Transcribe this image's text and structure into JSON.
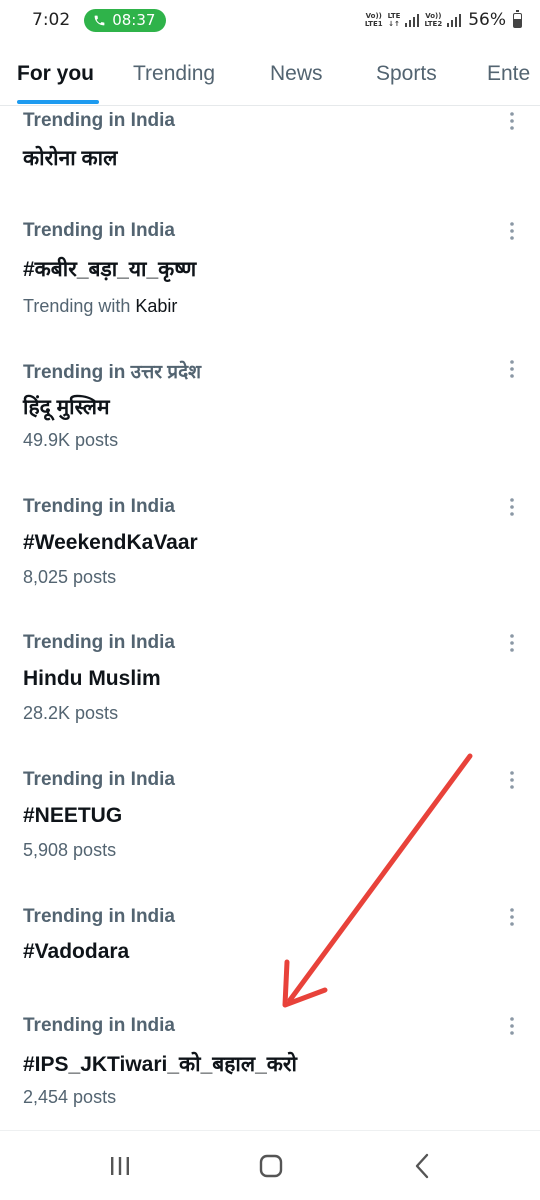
{
  "status_bar": {
    "time": "7:02",
    "call_timer": "08:37",
    "sim1_tag": [
      "Vo))",
      "LTE1"
    ],
    "lte_tag": [
      "LTE",
      "↓↑"
    ],
    "sim2_tag": [
      "Vo))",
      "LTE2"
    ],
    "battery": "56%",
    "battery_level": 0.56
  },
  "tabs": [
    {
      "label": "For you",
      "active": true
    },
    {
      "label": "Trending",
      "active": false
    },
    {
      "label": "News",
      "active": false
    },
    {
      "label": "Sports",
      "active": false
    },
    {
      "label": "Ente",
      "active": false
    }
  ],
  "trends": [
    {
      "context": "Trending in India",
      "title": "कोरोना काल",
      "meta": ""
    },
    {
      "context": "Trending in India",
      "title": "#कबीर_बड़ा_या_कृष्ण",
      "meta_prefix": "Trending with ",
      "meta_highlight": "Kabir"
    },
    {
      "context": "Trending in उत्तर प्रदेश",
      "title": "हिंदू मुस्लिम",
      "meta": "49.9K posts"
    },
    {
      "context": "Trending in India",
      "title": "#WeekendKaVaar",
      "meta": "8,025 posts"
    },
    {
      "context": "Trending in India",
      "title": "Hindu Muslim",
      "meta": "28.2K posts"
    },
    {
      "context": "Trending in India",
      "title": "#NEETUG",
      "meta": "5,908 posts"
    },
    {
      "context": "Trending in India",
      "title": "#Vadodara",
      "meta": ""
    },
    {
      "context": "Trending in India",
      "title": "#IPS_JKTiwari_को_बहाल_करो",
      "meta": "2,454 posts"
    }
  ],
  "colors": {
    "accent": "#1d9bf0",
    "call_green": "#2fb34a",
    "annotation_arrow": "#e8423a"
  },
  "icons": {
    "more": "more-vertical-icon",
    "call": "phone-icon",
    "nav_recents": "recent-apps-icon",
    "nav_home": "home-icon",
    "nav_back": "back-icon"
  }
}
